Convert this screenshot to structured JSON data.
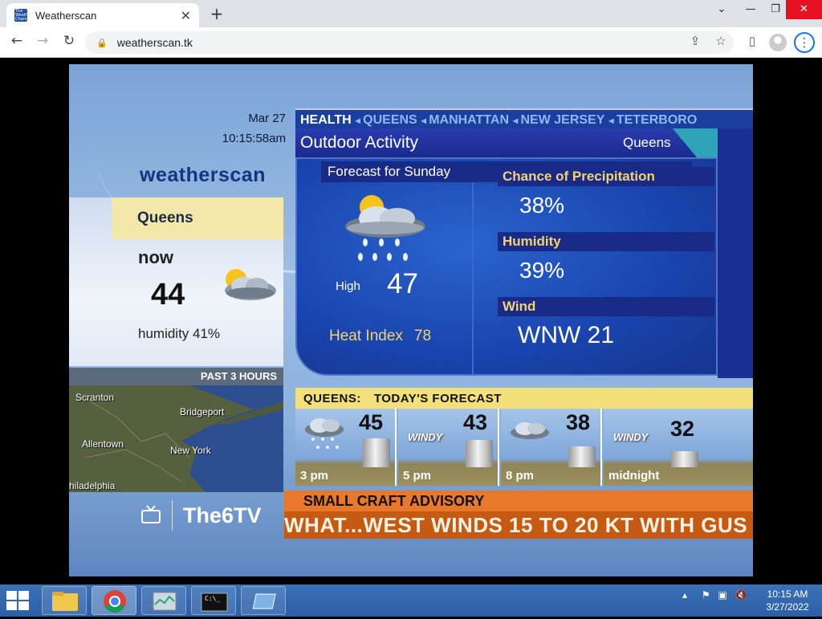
{
  "browser": {
    "tab_title": "Weatherscan",
    "favicon_text": "The Weather Channel",
    "url": "weatherscan.tk",
    "new_tab": "+",
    "tab_close": "✕"
  },
  "weatherscan": {
    "date": "Mar 27",
    "time": "10:15:58am",
    "logo": "weatherscan",
    "current": {
      "city": "Queens",
      "label": "now",
      "temp": "44",
      "humidity": "humidity 41%",
      "icon": "partly-cloudy-icon"
    },
    "radar": {
      "header": "PAST 3 HOURS",
      "labels": [
        "Scranton",
        "Bridgeport",
        "Allentown",
        "New York",
        "hiladelphia"
      ]
    },
    "channel": "The6TV",
    "ticker_top": {
      "current": "HEALTH",
      "locations": [
        "QUEENS",
        "MANHATTAN",
        "NEW JERSEY",
        "TETERBORO"
      ]
    },
    "outdoor": {
      "title": "Outdoor Activity",
      "city": "Queens",
      "subtitle": "Forecast for Sunday",
      "high_label": "High",
      "high_value": "47",
      "heat_label": "Heat Index",
      "heat_value": "78",
      "precip_label": "Chance of Precipitation",
      "precip_value": "38%",
      "humidity_label": "Humidity",
      "humidity_value": "39%",
      "wind_label": "Wind",
      "wind_value": "WNW 21",
      "icon": "sun-cloud-rain-icon"
    },
    "today": {
      "city": "QUEENS:",
      "title": "TODAY'S FORECAST",
      "periods": [
        {
          "time": "3 pm",
          "temp": "45",
          "icon": "cloud-rain-icon"
        },
        {
          "time": "5 pm",
          "temp": "43",
          "icon": "windy-icon",
          "icon_text": "WINDY"
        },
        {
          "time": "8 pm",
          "temp": "38",
          "icon": "cloud-icon"
        },
        {
          "time": "midnight",
          "temp": "32",
          "icon": "windy-icon",
          "icon_text": "WINDY"
        }
      ]
    },
    "advisory": {
      "title": "SMALL CRAFT ADVISORY",
      "crawl": "WHAT...WEST WINDS 15 TO 20 KT WITH GUS"
    }
  },
  "taskbar": {
    "clock_time": "10:15 AM",
    "clock_date": "3/27/2022",
    "cmd_text": "C:\\_"
  }
}
